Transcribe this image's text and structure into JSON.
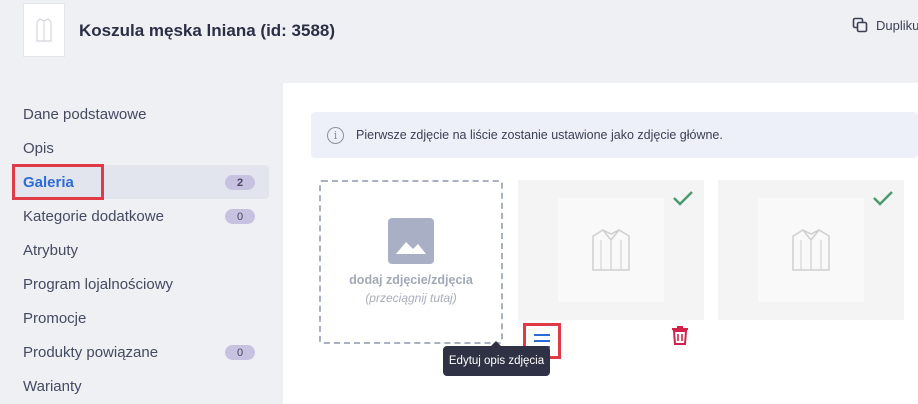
{
  "header": {
    "title": "Koszula męska lniana (id: 3588)",
    "duplicate_label": "Duplikuj"
  },
  "sidebar": {
    "items": [
      {
        "label": "Dane podstawowe",
        "badge": null,
        "active": false
      },
      {
        "label": "Opis",
        "badge": null,
        "active": false
      },
      {
        "label": "Galeria",
        "badge": "2",
        "active": true
      },
      {
        "label": "Kategorie dodatkowe",
        "badge": "0",
        "active": false
      },
      {
        "label": "Atrybuty",
        "badge": null,
        "active": false
      },
      {
        "label": "Program lojalnościowy",
        "badge": null,
        "active": false
      },
      {
        "label": "Promocje",
        "badge": null,
        "active": false
      },
      {
        "label": "Produkty powiązane",
        "badge": "0",
        "active": false
      },
      {
        "label": "Warianty",
        "badge": null,
        "active": false
      }
    ]
  },
  "gallery": {
    "info_text": "Pierwsze zdjęcie na liście zostanie ustawione jako zdjęcie główne.",
    "add_label": "dodaj zdjęcie/zdjęcia",
    "add_hint": "(przeciągnij tutaj)",
    "tooltip": "Edytuj opis zdjęcia",
    "photos": [
      {
        "icon": "shirt-image",
        "status_icon": "check-icon"
      },
      {
        "icon": "shirt-image",
        "status_icon": "check-icon"
      }
    ]
  },
  "colors": {
    "accent": "#2c6cd6",
    "highlight": "#e03a47",
    "check": "#4a9a6e",
    "delete": "#d0224a",
    "badge": "#c7c2e0"
  }
}
